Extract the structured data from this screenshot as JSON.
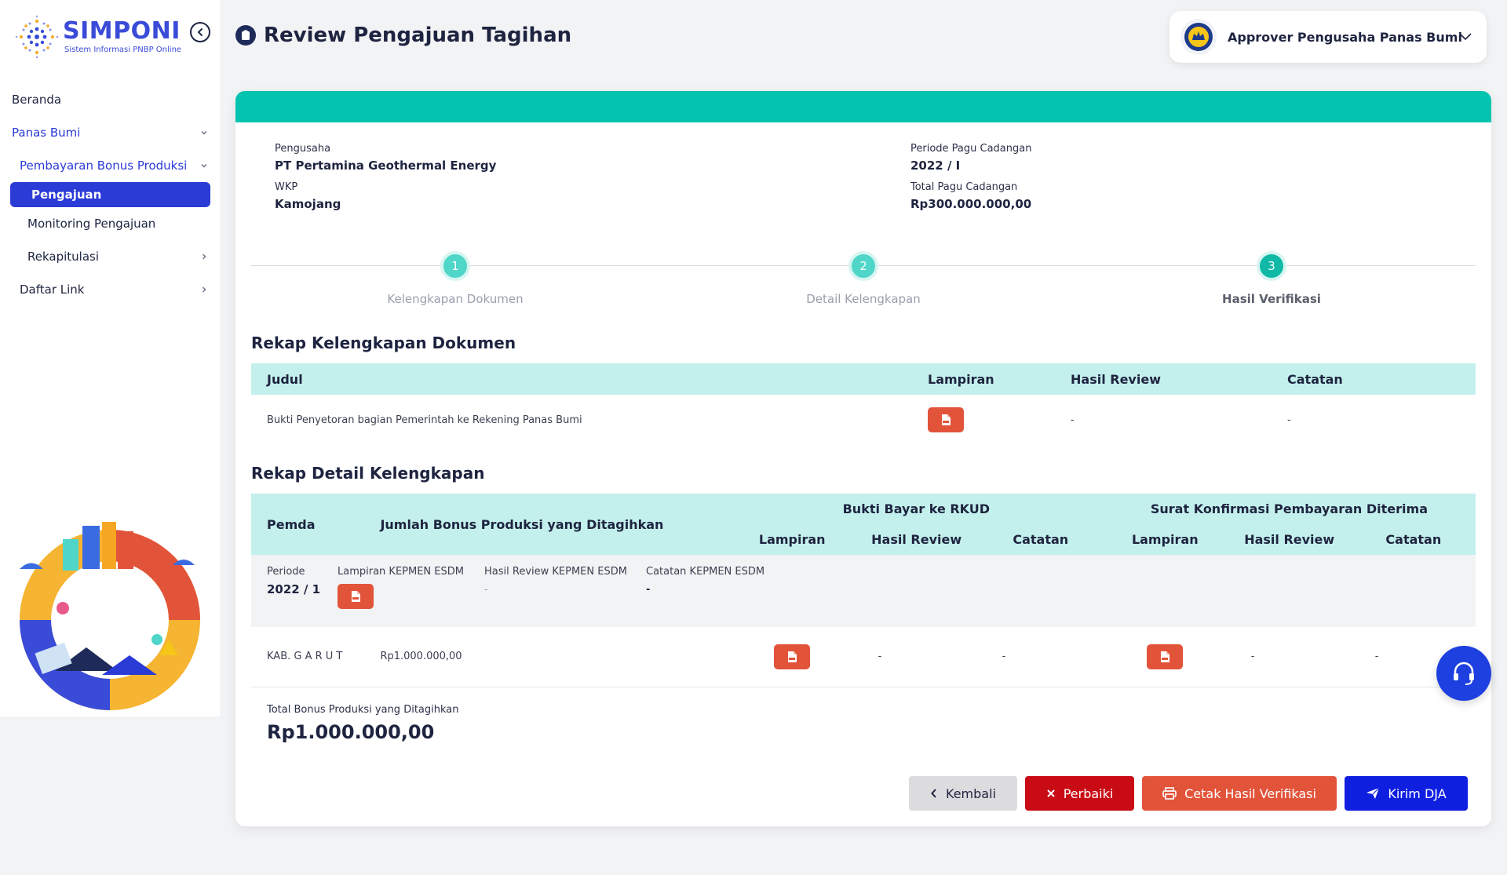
{
  "brand": {
    "title": "SIMPONI",
    "subtitle": "Sistem Informasi PNBP Online"
  },
  "page": {
    "title": "Review Pengajuan Tagihan"
  },
  "user": {
    "role": "Approver Pengusaha Panas Bumi"
  },
  "sidebar": {
    "items": [
      {
        "label": "Beranda"
      },
      {
        "label": "Panas Bumi"
      },
      {
        "label": "Pembayaran Bonus Produksi"
      },
      {
        "label": "Pengajuan"
      },
      {
        "label": "Monitoring Pengajuan"
      },
      {
        "label": "Rekapitulasi"
      },
      {
        "label": "Daftar Link"
      }
    ]
  },
  "info": {
    "pengusaha_label": "Pengusaha",
    "pengusaha": "PT Pertamina Geothermal Energy",
    "wkp_label": "WKP",
    "wkp": "Kamojang",
    "periode_label": "Periode Pagu Cadangan",
    "periode": "2022 / I",
    "total_pagu_label": "Total Pagu Cadangan",
    "total_pagu": "Rp300.000.000,00"
  },
  "steps": [
    {
      "num": "1",
      "label": "Kelengkapan Dokumen"
    },
    {
      "num": "2",
      "label": "Detail Kelengkapan"
    },
    {
      "num": "3",
      "label": "Hasil Verifikasi"
    }
  ],
  "rekap_dokumen": {
    "title": "Rekap Kelengkapan Dokumen",
    "headers": {
      "judul": "Judul",
      "lampiran": "Lampiran",
      "hasil": "Hasil Review",
      "catatan": "Catatan"
    },
    "row": {
      "judul": "Bukti Penyetoran bagian Pemerintah ke Rekening Panas Bumi",
      "hasil": "-",
      "catatan": "-"
    }
  },
  "rekap_detail": {
    "title": "Rekap Detail Kelengkapan",
    "headers": {
      "pemda": "Pemda",
      "jumlah": "Jumlah Bonus Produksi yang Ditagihkan",
      "bukti": "Bukti Bayar ke RKUD",
      "surat": "Surat Konfirmasi Pembayaran Diterima",
      "lampiran": "Lampiran",
      "hasil": "Hasil Review",
      "catatan": "Catatan"
    },
    "periode": {
      "label": "Periode",
      "value": "2022 / 1",
      "lampiran_label": "Lampiran KEPMEN ESDM",
      "hasil_label": "Hasil Review KEPMEN ESDM",
      "hasil_value": "-",
      "catatan_label": "Catatan KEPMEN ESDM",
      "catatan_value": "-"
    },
    "row": {
      "pemda": "KAB. G A R U T",
      "jumlah": "Rp1.000.000,00",
      "bukti_hasil": "-",
      "bukti_catatan": "-",
      "surat_hasil": "-",
      "surat_catatan": "-"
    },
    "total_label": "Total Bonus Produksi yang Ditagihkan",
    "total_value": "Rp1.000.000,00"
  },
  "actions": {
    "back": "Kembali",
    "fix": "Perbaiki",
    "print": "Cetak Hasil Verifikasi",
    "send": "Kirim DJA"
  },
  "icons": {
    "collapse": "chevron-left-circle-icon",
    "pdf": "pdf-file-icon",
    "support": "headset-icon"
  },
  "colors": {
    "primary": "#2b3bd6",
    "teal": "#04c4b0",
    "table_header": "#c3f0ec",
    "pdf": "#e2543a",
    "danger": "#c90b16",
    "send": "#0f1fe0"
  }
}
